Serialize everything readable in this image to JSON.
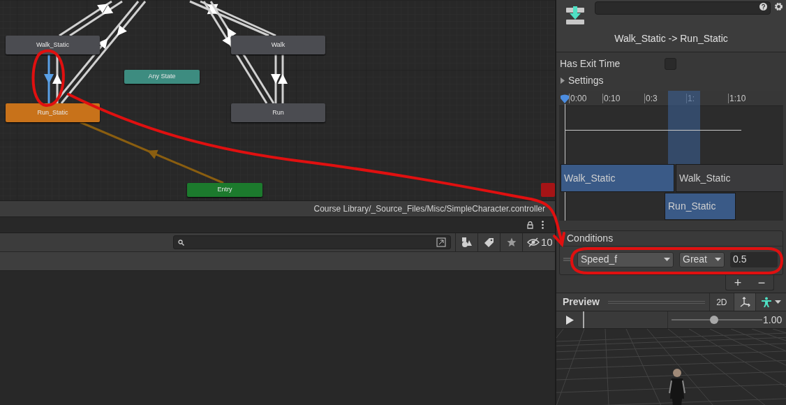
{
  "graph": {
    "states": [
      {
        "label": "Walk_Static",
        "color": "#4b4c51"
      },
      {
        "label": "Walk",
        "color": "#4b4c51"
      },
      {
        "label": "Any State",
        "color": "#3d8c80"
      },
      {
        "label": "Run_Static",
        "color": "#c8721a"
      },
      {
        "label": "Run",
        "color": "#4b4c51"
      },
      {
        "label": "Entry",
        "color": "#1c7a2d"
      }
    ]
  },
  "breadcrumb": "Course Library/_Source_Files/Misc/SimpleCharacter.controller",
  "project_toolbar": {
    "hidden_count": "10"
  },
  "inspector": {
    "title": "Walk_Static -> Run_Static",
    "has_exit_time": {
      "label": "Has Exit Time",
      "checked": false
    },
    "settings": {
      "label": "Settings",
      "expanded": false
    },
    "timeline": {
      "ticks": [
        "0:00",
        "0:10",
        "0:3",
        "1:",
        "1:10"
      ],
      "clips": [
        {
          "label": "Walk_Static",
          "kind": "source"
        },
        {
          "label": "Walk_Static",
          "kind": "loop"
        },
        {
          "label": "Run_Static",
          "kind": "target"
        }
      ]
    },
    "conditions": {
      "title": "Conditions",
      "items": [
        {
          "parameter": "Speed_f",
          "mode": "Great",
          "value": "0.5"
        }
      ],
      "add": "+",
      "remove": "−"
    },
    "preview": {
      "title": "Preview",
      "mode_button": "2D",
      "speed": {
        "level": 0.47,
        "reading": "1.00"
      }
    }
  }
}
